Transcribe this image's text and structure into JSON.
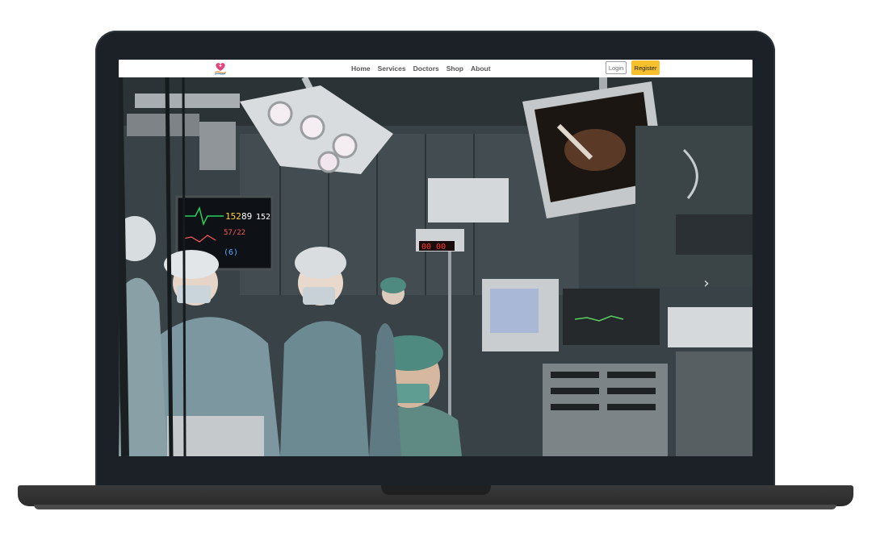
{
  "nav": {
    "links": [
      "Home",
      "Services",
      "Doctors",
      "Shop",
      "About"
    ],
    "login_label": "Login",
    "register_label": "Register"
  },
  "hero": {
    "image": "operating-room-surgeons-photo",
    "carousel_next_icon": "chevron-right-icon",
    "carousel_next_glyph": "›"
  },
  "monitor_readouts": {
    "heart_rate": "152",
    "spo2": "89",
    "pulse": "152",
    "blood_pressure": "57/22",
    "map": "(6)",
    "timer": "00 00"
  },
  "colors": {
    "register_button": "#f7c02c",
    "laptop_frame": "#1b2126",
    "navbar": "#ffffff"
  }
}
